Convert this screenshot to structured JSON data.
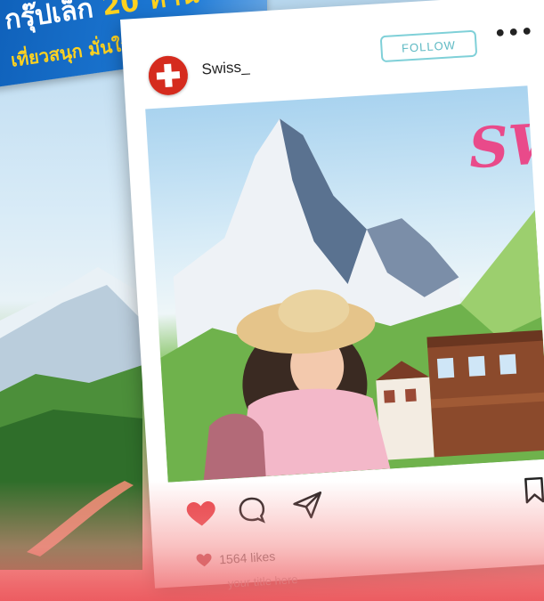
{
  "banner": {
    "line1_text": "กรุ๊ปเล็ก",
    "line1_number": "20 ท่าน",
    "line2_text": "เที่ยวสนุก มั่นใจ ปลอดภัย"
  },
  "post": {
    "username": "Swiss_",
    "follow_label": "FOLLOW",
    "more_label": "•••",
    "brand_text": "SW",
    "likes": "1564 likes",
    "caption": "your title here"
  },
  "colors": {
    "banner_blue": "#1e7ad6",
    "banner_yellow": "#ffd21f",
    "heart_red": "#e8454c",
    "follow_teal": "#5fbac4",
    "brand_pink": "#e94a8a",
    "swiss_red": "#d52b1e"
  },
  "icons": {
    "flag": "swiss-flag-icon",
    "like": "heart-icon",
    "comment": "comment-bubble-icon",
    "share": "paper-plane-icon",
    "save": "bookmark-icon"
  }
}
